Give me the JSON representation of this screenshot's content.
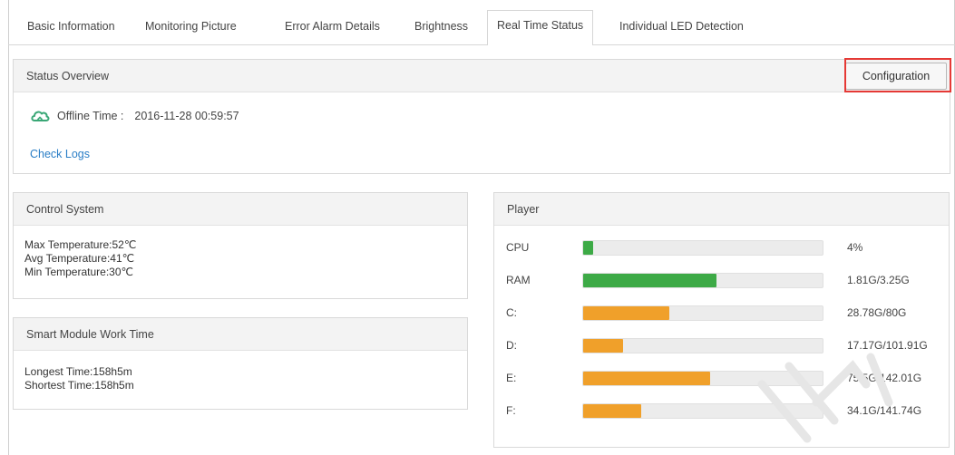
{
  "tabs": [
    {
      "label": "Basic Information",
      "active": false
    },
    {
      "label": "Monitoring Picture",
      "active": false
    },
    {
      "label": "Error Alarm Details",
      "active": false
    },
    {
      "label": "Brightness",
      "active": false
    },
    {
      "label": "Real Time Status",
      "active": true
    },
    {
      "label": "Individual LED Detection",
      "active": false
    }
  ],
  "status_overview": {
    "title": "Status Overview",
    "config_button": "Configuration",
    "offline_label": "Offline Time :",
    "offline_time": "2016-11-28 00:59:57",
    "check_logs": "Check Logs"
  },
  "control_system": {
    "title": "Control System",
    "lines": [
      "Max Temperature:52℃",
      "Avg Temperature:41℃",
      "Min Temperature:30℃"
    ]
  },
  "smart_module": {
    "title": "Smart Module Work Time",
    "lines": [
      "Longest Time:158h5m",
      "Shortest Time:158h5m"
    ]
  },
  "player": {
    "title": "Player",
    "rows": [
      {
        "label": "CPU",
        "fraction": 0.04,
        "value": "4%",
        "color": "#3daa46"
      },
      {
        "label": "RAM",
        "fraction": 0.557,
        "value": "1.81G/3.25G",
        "color": "#3daa46"
      },
      {
        "label": "C:",
        "fraction": 0.36,
        "value": "28.78G/80G",
        "color": "#f0a02a"
      },
      {
        "label": "D:",
        "fraction": 0.168,
        "value": "17.17G/101.91G",
        "color": "#f0a02a"
      },
      {
        "label": "E:",
        "fraction": 0.532,
        "value": "75.5G/142.01G",
        "color": "#f0a02a"
      },
      {
        "label": "F:",
        "fraction": 0.241,
        "value": "34.1G/141.74G",
        "color": "#f0a02a"
      }
    ]
  },
  "colors": {
    "link": "#2a7ec6",
    "highlight": "#e53935",
    "cloud": "#3aa776"
  },
  "icons": {
    "offline": "cloud-icon"
  }
}
